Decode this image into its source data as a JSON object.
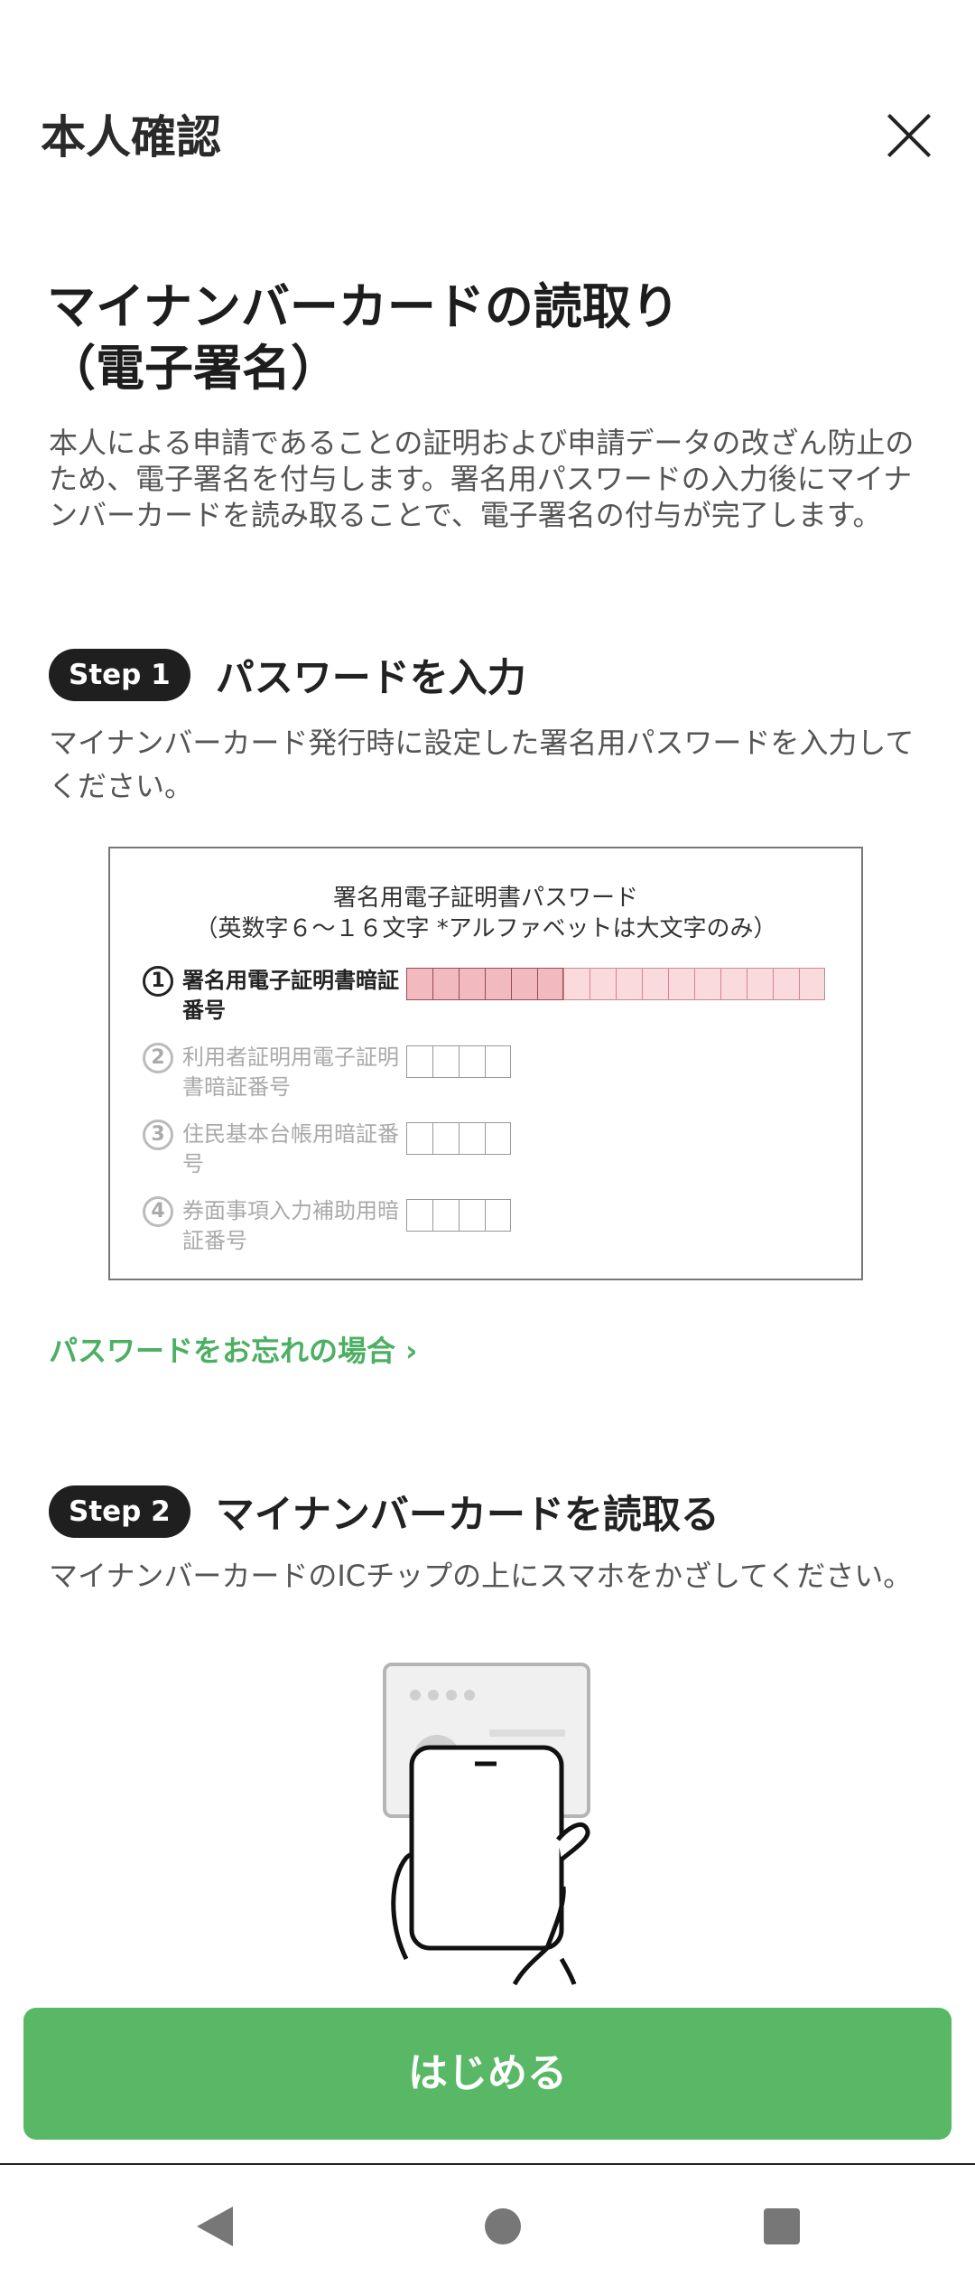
{
  "header": {
    "title": "本人確認"
  },
  "main": {
    "title_line1": "マイナンバーカードの読取り",
    "title_line2": "（電子署名）",
    "intro": "本人による申請であることの証明および申請データの改ざん防止のため、電子署名を付与します。署名用パスワードの入力後にマイナンバーカードを読み取ることで、電子署名の付与が完了します。"
  },
  "step1": {
    "badge": "Step 1",
    "title": "パスワードを入力",
    "desc": "マイナンバーカード発行時に設定した署名用パスワードを入力してください。",
    "box_title": "署名用電子証明書パスワード",
    "box_subtitle": "（英数字６～１６文字 *アルファベットは大文字のみ）",
    "rows": [
      {
        "num": "1",
        "label": "署名用電子証明書暗証番号"
      },
      {
        "num": "2",
        "label": "利用者証明用電子証明書暗証番号"
      },
      {
        "num": "3",
        "label": "住民基本台帳用暗証番号"
      },
      {
        "num": "4",
        "label": "券面事項入力補助用暗証番号"
      }
    ],
    "forgot_link": "パスワードをお忘れの場合 ›"
  },
  "step2": {
    "badge": "Step 2",
    "title": "マイナンバーカードを読取る",
    "desc": "マイナンバーカードのICチップの上にスマホをかざしてください。"
  },
  "footer": {
    "start_button": "はじめる"
  },
  "colors": {
    "accent": "#58b866",
    "link": "#4caf62",
    "highlight": "#f2b9bf"
  },
  "icons": {
    "close": "close-icon",
    "back": "back-icon",
    "home": "home-icon",
    "recent": "recent-apps-icon"
  }
}
